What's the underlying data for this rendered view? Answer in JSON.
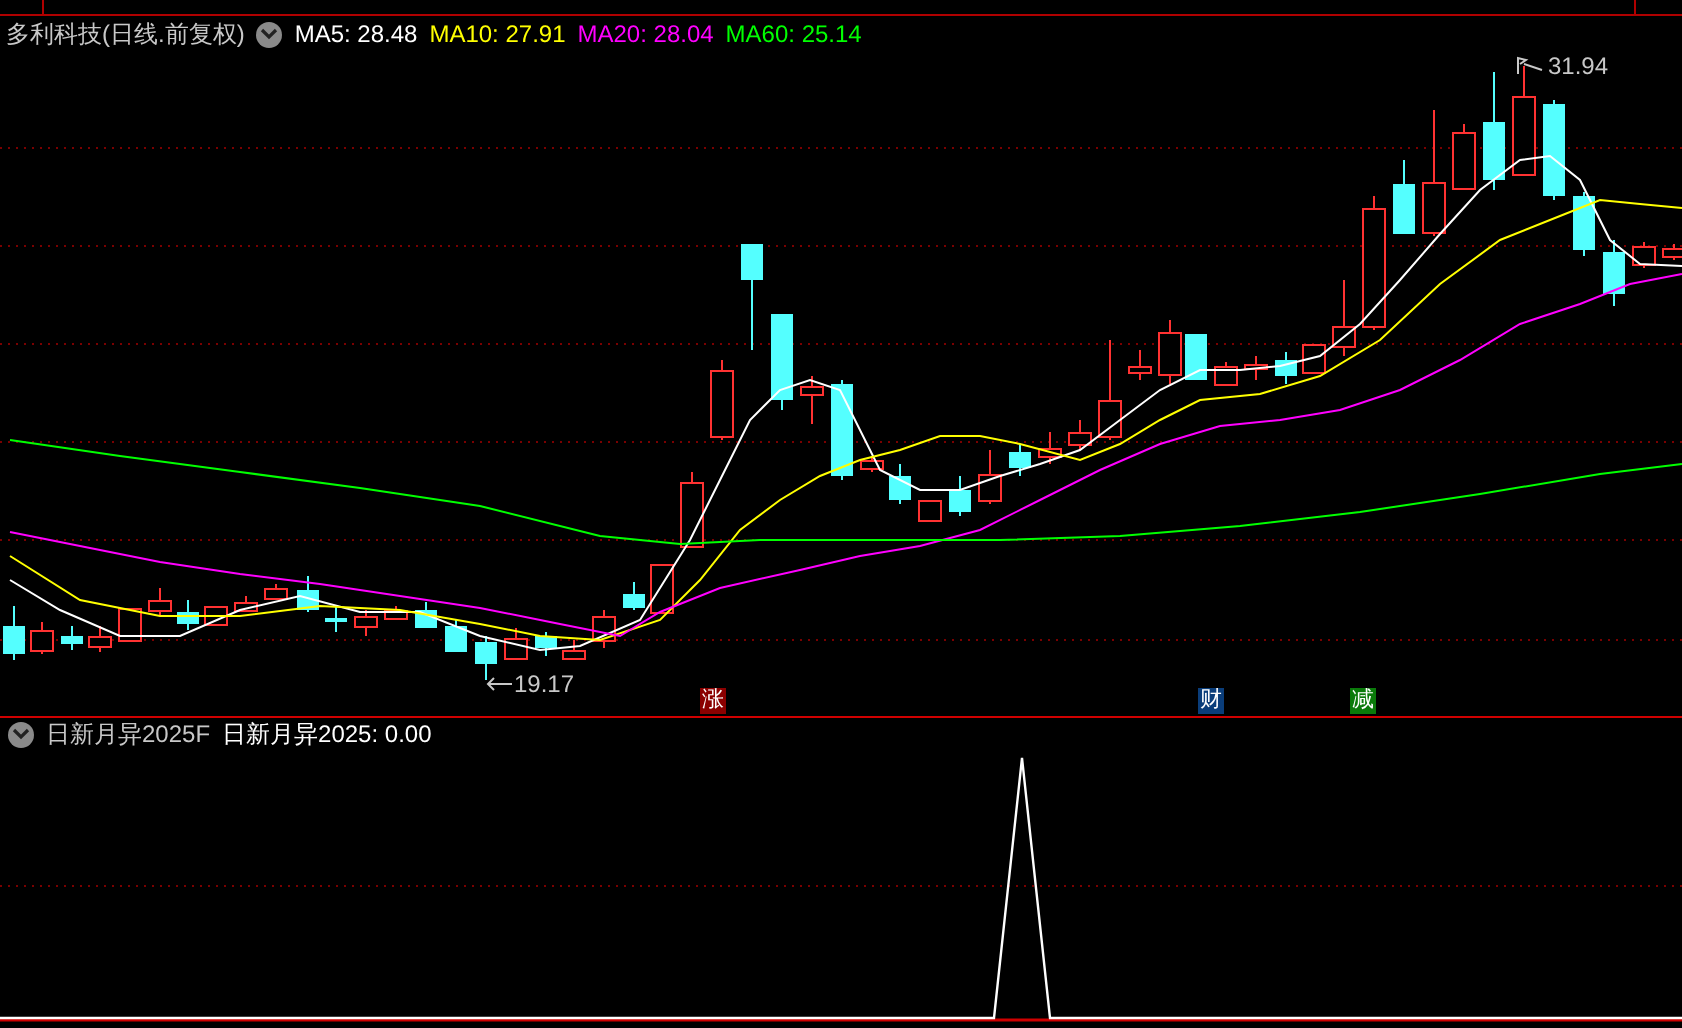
{
  "chart_header": {
    "title": "多利科技(日线.前复权)",
    "ma_legend": [
      {
        "text": "MA5: 28.48",
        "color": "#ffffff"
      },
      {
        "text": "MA10: 27.91",
        "color": "#ffff00"
      },
      {
        "text": "MA20: 28.04",
        "color": "#ff00ff"
      },
      {
        "text": "MA60: 25.14",
        "color": "#00ff00"
      }
    ]
  },
  "price_labels": {
    "high": "31.94",
    "low": "19.17"
  },
  "event_markers": [
    {
      "text": "涨",
      "color": "#8b0000"
    },
    {
      "text": "财",
      "color": "#0a3d7a"
    },
    {
      "text": "减",
      "color": "#0a7a0a"
    }
  ],
  "indicator": {
    "name": "日新月异2025F",
    "reading": "日新月异2025: 0.00"
  }
}
